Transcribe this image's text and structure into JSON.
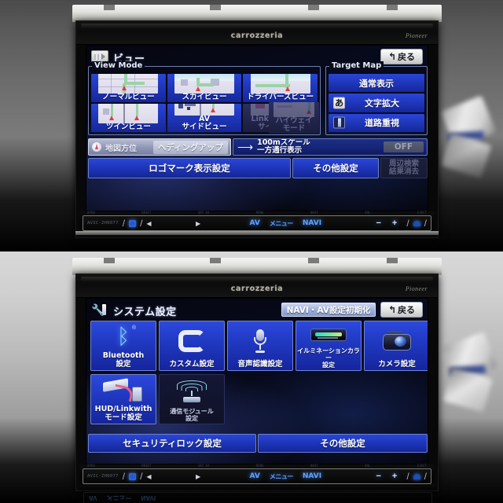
{
  "device": {
    "brand_top": "carrozzeria",
    "brand_right": "Pioneer",
    "model_code": "AVIC-ZH0077"
  },
  "screen_view": {
    "title": "ビュー",
    "title_icon": "map-view-icon",
    "back_button": "戻る",
    "back_icon": "↰",
    "view_mode_group_label": "View Mode",
    "target_map_group_label": "Target Map",
    "view_modes": [
      {
        "label": "ノーマルビュー",
        "thumb": "normal-map",
        "enabled": true
      },
      {
        "label": "スカイビュー",
        "thumb": "sky-map",
        "enabled": true
      },
      {
        "label": "ドライバーズビュー",
        "thumb": "driver-map",
        "enabled": true
      },
      {
        "label": "ツインビュー",
        "thumb": "twin-map",
        "enabled": true
      },
      {
        "label": "AV\nサイドビュー",
        "thumb": "av-side-map",
        "enabled": true
      },
      {
        "label": "Linkwithモード\nサイドビュー",
        "thumb": "linkwith-map",
        "enabled": false
      },
      {
        "label": "ハイウェイ\nモード",
        "thumb": "highway-map",
        "enabled": false
      }
    ],
    "target_map": [
      {
        "label": "通常表示",
        "icon": "none"
      },
      {
        "label": "文字拡大",
        "icon": "kana-a-icon",
        "icon_text": "あ"
      },
      {
        "label": "道路重視",
        "icon": "road-icon"
      }
    ],
    "map_orientation": {
      "label": "地図方位",
      "value": "ヘディングアップ",
      "icon": "compass-icon"
    },
    "oneway_display": {
      "label": "100mスケール\n一方通行表示",
      "value": "OFF",
      "icon": "arrow-right-icon"
    },
    "logo_button": "ロゴマーク表示設定",
    "other_button": "その他設定",
    "clear_results_button": "周辺検索\n結果消去"
  },
  "screen_system": {
    "title": "システム設定",
    "title_icon": "wrench-icon",
    "init_button": "NAVI・AV設定初期化",
    "back_button": "戻る",
    "back_icon": "↰",
    "tiles": [
      {
        "label": "Bluetooth\n設定",
        "icon": "bluetooth-icon",
        "enabled": true,
        "small": false
      },
      {
        "label": "カスタム設定",
        "icon": "custom-c-icon",
        "enabled": true,
        "small": false
      },
      {
        "label": "音声認識設定",
        "icon": "microphone-icon",
        "enabled": true,
        "small": false
      },
      {
        "label": "イルミネーションカラー\n設定",
        "icon": "illumination-icon",
        "enabled": true,
        "small": true
      },
      {
        "label": "カメラ設定",
        "icon": "camera-icon",
        "enabled": true,
        "small": false
      },
      {
        "label": "HUD/Linkwith\nモード設定",
        "icon": "hud-linkwith-icon",
        "enabled": true,
        "small": false
      },
      {
        "label": "通信モジュール\n設定",
        "icon": "comm-module-icon",
        "enabled": false,
        "small": true
      }
    ],
    "security_button": "セキュリティロック設定",
    "other_button": "その他設定"
  },
  "hard_controls": {
    "model_label": "AVIC-ZH0077",
    "av_label": "AV",
    "menu_label": "メニュー",
    "navi_label": "NAVI",
    "minus_label": "−",
    "plus_label": "+",
    "eject_icon": "eject-icon",
    "open_icon": "open-tray-icon",
    "prev_icon": "◀",
    "next_icon": "▶"
  },
  "colors": {
    "accent_blue": "#2a46d6",
    "screen_bg": "#05060f",
    "glow_blue": "#5ea2ff",
    "bezel": "#0b0b0b",
    "disabled": "#1c1f3a"
  }
}
